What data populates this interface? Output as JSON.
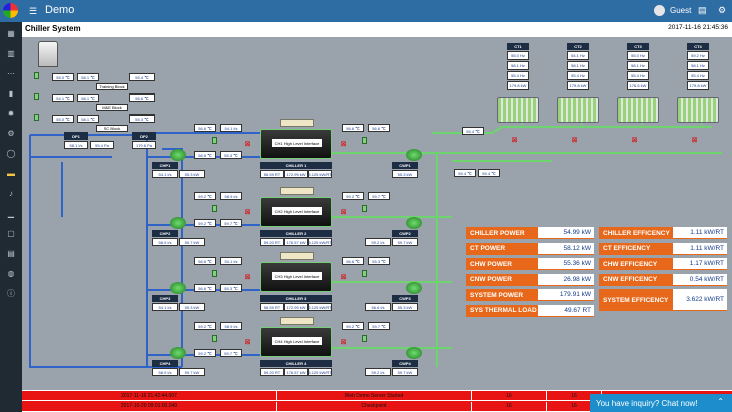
{
  "app": {
    "title": "Demo",
    "user": "Guest",
    "page_title": "Chiller System",
    "datetime": "2017-11-16 21:45:36"
  },
  "sidebar": {
    "icons": [
      "dashboard-icon",
      "chart-icon",
      "network-icon",
      "book-icon",
      "gear-icon",
      "gear-alt-icon",
      "bulb-icon",
      "folder-icon",
      "bell-icon",
      "bar-chart-icon",
      "copy-icon",
      "list-icon",
      "database-icon",
      "info-icon"
    ]
  },
  "blocks": [
    {
      "name": "Training Block",
      "left": "55.0 ℃",
      "right": "58.1 ℃",
      "side": "55.4 ℃",
      "side2": "56.6 ℃"
    },
    {
      "name": "M&E Block",
      "left": "54.1 ℃",
      "right": "58.1 ℃",
      "side": "56.6 ℃",
      "side2": "55.5 ℃"
    },
    {
      "name": "SC Block",
      "left": "55.0 ℃",
      "right": "58.1 ℃",
      "side": "55.3 ℃"
    }
  ],
  "dp": {
    "dp1": "DP1",
    "dp1_val1": "58.1 l/s",
    "dp1_val2": "55.4 Pa",
    "dp2": "DP2",
    "dp2_val": "179.8 Pa"
  },
  "cts": [
    {
      "label": "CT1",
      "v": [
        "55.0 Hz",
        "58.1 Hz",
        "55.4 Hz",
        "179.8 kW"
      ]
    },
    {
      "label": "CT2",
      "v": [
        "54.1 Hz",
        "58.1 Hz",
        "55.4 Hz",
        "179.8 kW"
      ]
    },
    {
      "label": "CT3",
      "v": [
        "55.0 Hz",
        "58.1 Hz",
        "55.4 Hz",
        "176.6 kW"
      ]
    },
    {
      "label": "CT4",
      "v": [
        "59.2 Hz",
        "58.1 Hz",
        "55.4 Hz",
        "179.8 kW"
      ]
    }
  ],
  "ct_line": {
    "v1": "55.4 ℃",
    "v2": "55.4 ℃",
    "v3": "55.4 ℃"
  },
  "chillers": [
    {
      "iface": "CH1 High Level Interface",
      "name": "CHILLER 1",
      "stats": [
        "56.59 RT",
        "172.99 kW",
        "3.125 kW/RT"
      ],
      "chwp": "CHP1",
      "chwp_vals": [
        "54.1 l/s",
        "55.3 kW"
      ],
      "cwp": "CWP1",
      "cwp_vals": [
        "",
        "55.3 kW"
      ],
      "t": [
        "56.6 ℃",
        "54.1 l/s",
        "56.6 ℃",
        "55.3 ℃",
        "56.6 ℃",
        "56.6 ℃"
      ]
    },
    {
      "iface": "CH2 High Level Interface",
      "name": "CHILLER 2",
      "stats": [
        "59.20 RT",
        "176.57 kW",
        "3.125 kW/RT"
      ],
      "chwp": "CHP2",
      "chwp_vals": [
        "58.9 l/s",
        "59.7 kW"
      ],
      "cwp": "CWP2",
      "cwp_vals": [
        "59.2 l/s",
        "59.7 kW"
      ],
      "t": [
        "59.2 ℃",
        "58.9 l/s",
        "59.2 ℃",
        "59.7 ℃",
        "59.2 ℃",
        "59.7 ℃"
      ]
    },
    {
      "iface": "CH3 High Level Interface",
      "name": "CHILLER 3",
      "stats": [
        "56.59 RT",
        "172.99 kW",
        "3.125 kW/RT"
      ],
      "chwp": "CHP3",
      "chwp_vals": [
        "54.1 l/s",
        "55.3 kW"
      ],
      "cwp": "CWP3",
      "cwp_vals": [
        "56.6 l/s",
        "55.3 kW"
      ],
      "t": [
        "56.6 ℃",
        "54.1 l/s",
        "56.6 ℃",
        "55.3 ℃",
        "56.6 ℃",
        "55.3 ℃"
      ]
    },
    {
      "iface": "CH4 High Level Interface",
      "name": "CHILLER 4",
      "stats": [
        "59.20 RT",
        "176.57 kW",
        "3.125 kW/RT"
      ],
      "chwp": "CHP4",
      "chwp_vals": [
        "58.9 l/s",
        "59.7 kW"
      ],
      "cwp": "CWP4",
      "cwp_vals": [
        "59.2 l/s",
        "59.7 kW"
      ],
      "t": [
        "59.2 ℃",
        "58.9 l/s",
        "59.2 ℃",
        "59.7 ℃",
        "59.2 ℃",
        "59.7 ℃"
      ]
    }
  ],
  "kpis_left": [
    {
      "label": "CHILLER POWER",
      "value": "54.99 kW"
    },
    {
      "label": "CT POWER",
      "value": "58.12 kW"
    },
    {
      "label": "CHW POWER",
      "value": "55.36 kW"
    },
    {
      "label": "CNW POWER",
      "value": "26.98 kW"
    },
    {
      "label": "SYSTEM POWER",
      "value": "179.91 kW"
    },
    {
      "label": "SYS THERMAL LOAD",
      "value": "49.67 RT"
    }
  ],
  "kpis_right": [
    {
      "label": "CHILLER EFFICENCY",
      "value": "1.11 kW/RT"
    },
    {
      "label": "CT EFFICENCY",
      "value": "1.11 kW/RT"
    },
    {
      "label": "CHW EFFICENCY",
      "value": "1.17 kW/RT"
    },
    {
      "label": "CNW EFFICENCY",
      "value": "0.54 kW/RT"
    },
    {
      "label": "SYSTEM EFFICENCY",
      "value": "3.622 kW/RT"
    }
  ],
  "alarms": [
    {
      "time": "2017-11-16 21:42:44.007",
      "msg": "Web Demo Server Started",
      "code": "16",
      "count": "16"
    },
    {
      "time": "2017-10-20 09:01:00.049",
      "msg": "Checkpoint",
      "code": "16",
      "count": "16"
    }
  ],
  "chat": {
    "label": "You have inquiry? Chat now!"
  },
  "colors": {
    "topbar": "#2e6ca4",
    "sidebar": "#1f2a33",
    "chw_pipe": "#2f63c8",
    "cw_pipe": "#6ed46e",
    "kpi": "#e8681b",
    "alarm": "#e81414"
  }
}
